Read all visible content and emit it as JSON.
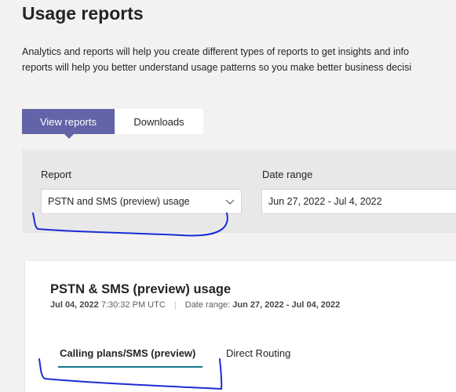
{
  "page": {
    "title": "Usage reports",
    "description_line1": "Analytics and reports will help you create different types of reports to get insights and info",
    "description_line2": "reports will help you better understand usage patterns so you make better business decisi"
  },
  "tabs": {
    "view_reports": "View reports",
    "downloads": "Downloads"
  },
  "filters": {
    "report_label": "Report",
    "report_value": "PSTN and SMS (preview) usage",
    "date_label": "Date range",
    "date_value": "Jun 27, 2022 - Jul 4, 2022"
  },
  "card": {
    "title": "PSTN & SMS (preview) usage",
    "meta_date": "Jul 04, 2022",
    "meta_time": "7:30:32 PM UTC",
    "meta_range_label": "Date range:",
    "meta_range_value": "Jun 27, 2022 - Jul 04, 2022",
    "tabs": [
      {
        "label": "Calling plans/SMS (preview)"
      },
      {
        "label": "Direct Routing"
      }
    ]
  },
  "colors": {
    "accent": "#6264a7",
    "tab_underline": "#0f7a8a",
    "annotation_ink": "#1a2cd6"
  },
  "icons": {
    "report_dropdown": "chevron-down-icon"
  }
}
